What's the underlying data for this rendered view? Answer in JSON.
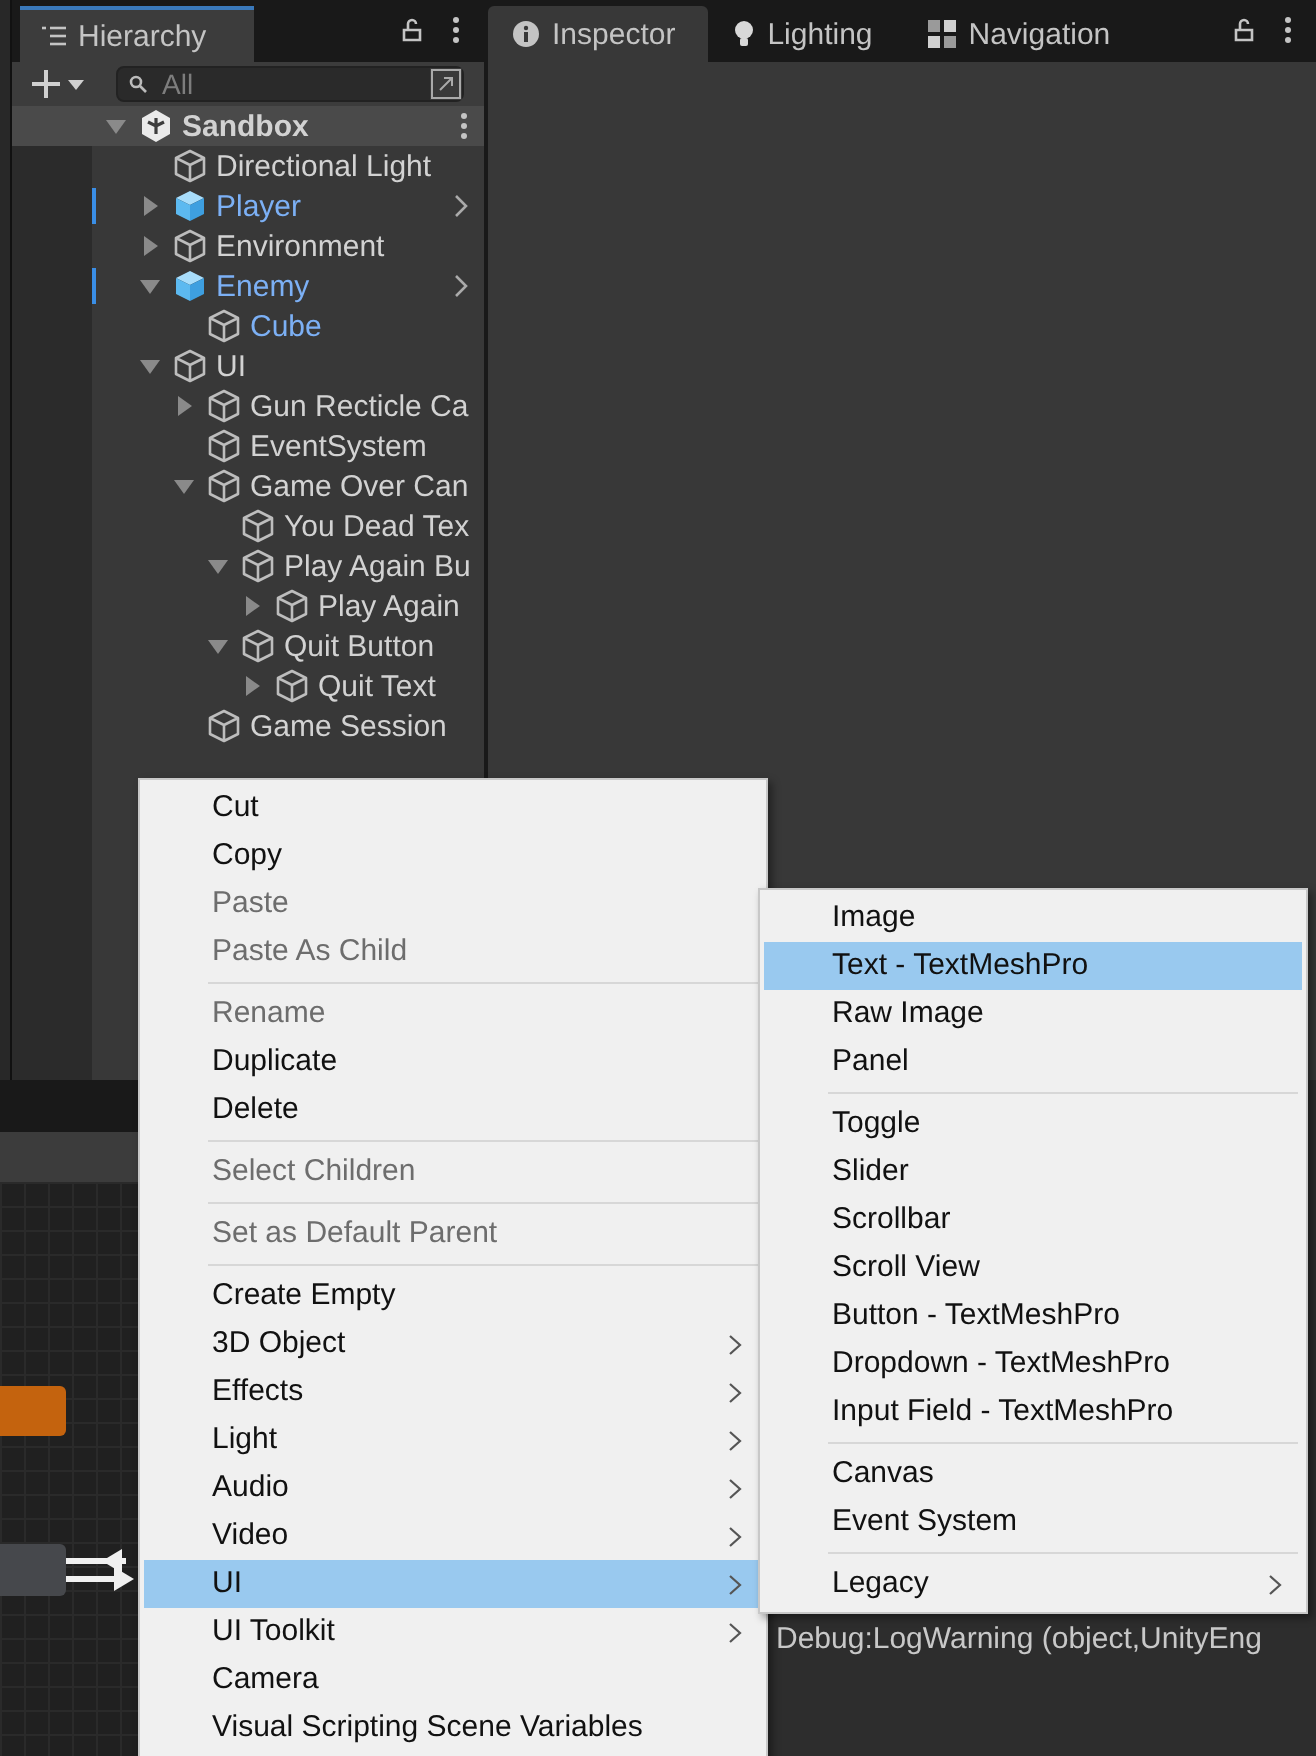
{
  "hierarchy": {
    "tab": {
      "label": "Hierarchy",
      "selected": true
    },
    "search": {
      "placeholder": "All"
    },
    "tree": [
      {
        "name": "Sandbox",
        "kind": "scene",
        "expanded": true,
        "selected": true,
        "in_prefab": false,
        "children": [
          {
            "name": "Directional Light",
            "kind": "object",
            "in_prefab": false,
            "selected": false
          },
          {
            "name": "Player",
            "kind": "prefab",
            "expanded": false,
            "in_prefab": true,
            "selected": false
          },
          {
            "name": "Environment",
            "kind": "object",
            "expanded": false,
            "in_prefab": false,
            "selected": false
          },
          {
            "name": "Enemy",
            "kind": "prefab",
            "expanded": true,
            "in_prefab": true,
            "selected": false,
            "children": [
              {
                "name": "Cube",
                "kind": "object",
                "in_prefab": true,
                "selected": false
              }
            ]
          },
          {
            "name": "UI",
            "kind": "object",
            "expanded": true,
            "in_prefab": false,
            "selected": false,
            "children": [
              {
                "name": "Gun Recticle Ca",
                "kind": "object",
                "expanded": false,
                "in_prefab": false,
                "selected": false
              },
              {
                "name": "EventSystem",
                "kind": "object",
                "in_prefab": false,
                "selected": false
              },
              {
                "name": "Game Over Can",
                "kind": "object",
                "expanded": true,
                "in_prefab": false,
                "selected": false,
                "children": [
                  {
                    "name": "You Dead Tex",
                    "kind": "object",
                    "in_prefab": false,
                    "selected": false
                  },
                  {
                    "name": "Play Again Bu",
                    "kind": "object",
                    "expanded": true,
                    "in_prefab": false,
                    "selected": false,
                    "children": [
                      {
                        "name": "Play Again",
                        "kind": "object",
                        "expanded": false,
                        "in_prefab": false,
                        "selected": false
                      }
                    ]
                  },
                  {
                    "name": "Quit Button",
                    "kind": "object",
                    "expanded": true,
                    "in_prefab": false,
                    "selected": false,
                    "children": [
                      {
                        "name": "Quit Text",
                        "kind": "object",
                        "expanded": false,
                        "in_prefab": false,
                        "selected": false
                      }
                    ]
                  }
                ]
              },
              {
                "name": "Game Session",
                "kind": "object",
                "in_prefab": false,
                "selected": false
              }
            ]
          }
        ]
      }
    ]
  },
  "right_tabs": [
    {
      "label": "Inspector",
      "kind": "info",
      "selected": true
    },
    {
      "label": "Lighting",
      "kind": "bulb",
      "selected": false
    },
    {
      "label": "Navigation",
      "kind": "nav",
      "selected": false
    }
  ],
  "console": {
    "line": "Debug:LogWarning (object,UnityEng"
  },
  "context_menu": [
    {
      "kind": "item",
      "label": "Cut",
      "disabled": false
    },
    {
      "kind": "item",
      "label": "Copy",
      "disabled": false
    },
    {
      "kind": "item",
      "label": "Paste",
      "disabled": true
    },
    {
      "kind": "item",
      "label": "Paste As Child",
      "disabled": true
    },
    {
      "kind": "separator"
    },
    {
      "kind": "item",
      "label": "Rename",
      "disabled": true
    },
    {
      "kind": "item",
      "label": "Duplicate",
      "disabled": false
    },
    {
      "kind": "item",
      "label": "Delete",
      "disabled": false
    },
    {
      "kind": "separator"
    },
    {
      "kind": "item",
      "label": "Select Children",
      "disabled": true
    },
    {
      "kind": "separator"
    },
    {
      "kind": "item",
      "label": "Set as Default Parent",
      "disabled": true
    },
    {
      "kind": "separator"
    },
    {
      "kind": "item",
      "label": "Create Empty",
      "disabled": false
    },
    {
      "kind": "submenu",
      "label": "3D Object",
      "selected": false
    },
    {
      "kind": "submenu",
      "label": "Effects",
      "selected": false
    },
    {
      "kind": "submenu",
      "label": "Light",
      "selected": false
    },
    {
      "kind": "submenu",
      "label": "Audio",
      "selected": false
    },
    {
      "kind": "submenu",
      "label": "Video",
      "selected": false
    },
    {
      "kind": "submenu",
      "label": "UI",
      "selected": true
    },
    {
      "kind": "submenu",
      "label": "UI Toolkit",
      "selected": false
    },
    {
      "kind": "item",
      "label": "Camera",
      "disabled": false
    },
    {
      "kind": "item",
      "label": "Visual Scripting Scene Variables",
      "disabled": false
    }
  ],
  "ui_submenu": [
    {
      "kind": "item",
      "label": "Image",
      "selected": false
    },
    {
      "kind": "item",
      "label": "Text - TextMeshPro",
      "selected": true
    },
    {
      "kind": "item",
      "label": "Raw Image",
      "selected": false
    },
    {
      "kind": "item",
      "label": "Panel",
      "selected": false
    },
    {
      "kind": "separator"
    },
    {
      "kind": "item",
      "label": "Toggle",
      "selected": false
    },
    {
      "kind": "item",
      "label": "Slider",
      "selected": false
    },
    {
      "kind": "item",
      "label": "Scrollbar",
      "selected": false
    },
    {
      "kind": "item",
      "label": "Scroll View",
      "selected": false
    },
    {
      "kind": "item",
      "label": "Button - TextMeshPro",
      "selected": false
    },
    {
      "kind": "item",
      "label": "Dropdown - TextMeshPro",
      "selected": false
    },
    {
      "kind": "item",
      "label": "Input Field - TextMeshPro",
      "selected": false
    },
    {
      "kind": "separator"
    },
    {
      "kind": "item",
      "label": "Canvas",
      "selected": false
    },
    {
      "kind": "item",
      "label": "Event System",
      "selected": false
    },
    {
      "kind": "separator"
    },
    {
      "kind": "submenu",
      "label": "Legacy",
      "selected": false
    }
  ]
}
